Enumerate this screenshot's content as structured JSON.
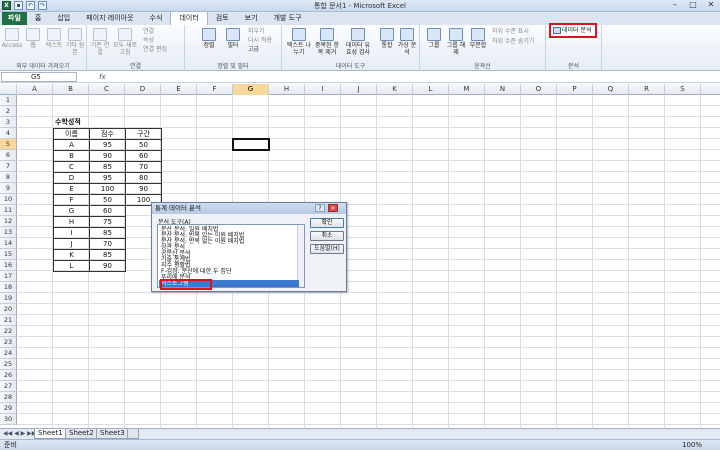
{
  "window": {
    "title": "통합 문서1 - Microsoft Excel"
  },
  "qat": {
    "undo": "↶",
    "redo": "↷",
    "save": "▪"
  },
  "ribbon_tabs": [
    "파일",
    "홈",
    "삽입",
    "페이지 레이아웃",
    "수식",
    "데이터",
    "검토",
    "보기",
    "개발 도구"
  ],
  "ribbon": {
    "groups": {
      "external": "외부 데이터 가져오기",
      "connections": "연결",
      "sort_filter": "정렬 및 필터",
      "data_tools": "데이터 도구",
      "outline": "윤곽선",
      "analysis": "분석"
    },
    "buttons": {
      "access": "Access",
      "web": "웹",
      "text": "텍스트",
      "other": "기타 원본",
      "existing": "기존 연결",
      "refresh": "모두 새로 고침",
      "connections": "연결",
      "properties": "속성",
      "edit_links": "연결 편집",
      "sort": "정렬",
      "filter": "필터",
      "clear": "지우기",
      "reapply": "다시 적용",
      "advanced": "고급",
      "text_to_col": "텍스트 나누기",
      "remove_dup": "중복된 항목 제거",
      "validation": "데이터 유효성 검사",
      "consolidate": "통합",
      "whatif": "가상 분석",
      "group": "그룹",
      "ungroup": "그룹 해제",
      "subtotal": "부분합",
      "show_detail": "하위 수준 표시",
      "hide_detail": "하위 수준 숨기기",
      "data_analysis": "데이터 분석"
    }
  },
  "formula_bar": {
    "name_box": "G5",
    "fx": "fx",
    "content": ""
  },
  "columns": [
    "A",
    "B",
    "C",
    "D",
    "E",
    "F",
    "G",
    "H",
    "I",
    "J",
    "K",
    "L",
    "M",
    "N",
    "O",
    "P",
    "Q",
    "R",
    "S"
  ],
  "rows": [
    "1",
    "2",
    "3",
    "4",
    "5",
    "6",
    "7",
    "8",
    "9",
    "10",
    "11",
    "12",
    "13",
    "14",
    "15",
    "16",
    "17",
    "18",
    "19",
    "20",
    "21",
    "22",
    "23",
    "24",
    "25",
    "26",
    "27",
    "28",
    "29",
    "30"
  ],
  "sheet": {
    "heading": "수학성적",
    "table": {
      "headers": [
        "이름",
        "점수",
        "구간"
      ],
      "names": [
        "A",
        "B",
        "C",
        "D",
        "E",
        "F",
        "G",
        "H",
        "I",
        "J",
        "K",
        "L"
      ],
      "scores": [
        "95",
        "90",
        "85",
        "95",
        "100",
        "50",
        "60",
        "75",
        "85",
        "70",
        "85",
        "90"
      ],
      "bins": [
        "50",
        "60",
        "70",
        "80",
        "90",
        "100"
      ]
    },
    "tabs": [
      "Sheet1",
      "Sheet2",
      "Sheet3"
    ]
  },
  "status": {
    "ready": "준비",
    "zoom": "100%"
  },
  "dialog": {
    "title": "통계 데이터 분석",
    "list_label": "분석 도구(A)",
    "items": [
      "분산 분석: 일원 배치법",
      "분산 분석: 반복 있는 이원 배치법",
      "분산 분석: 반복 없는 이원 배치법",
      "상관 분석",
      "공분산 분석",
      "기술 통계법",
      "지수 평활법",
      "F-검정: 분산에 대한 두 집단",
      "푸리에 분석",
      "히스토그램"
    ],
    "ok": "확인",
    "cancel": "취소",
    "help": "도움말(H)"
  }
}
